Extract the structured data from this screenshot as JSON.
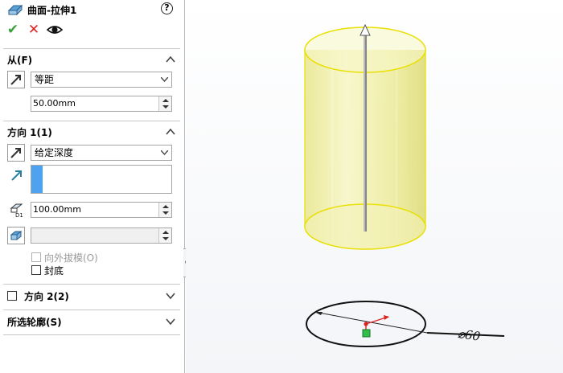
{
  "header": {
    "title": "曲面-拉伸1",
    "help": "?"
  },
  "actions": {
    "ok": "✔",
    "cancel": "✕"
  },
  "from": {
    "title": "从(F)",
    "type_value": "等距",
    "offset_value": "50.00mm"
  },
  "direction1": {
    "title": "方向 1(1)",
    "type_value": "给定深度",
    "depth_value": "100.00mm",
    "draft_value": "",
    "draft_outward_label": "向外拔模(O)",
    "cap_label": "封底"
  },
  "direction2": {
    "title": "方向 2(2)"
  },
  "contours": {
    "title": "所选轮廓(S)"
  },
  "viewport": {
    "dimension_label": "⌀60"
  },
  "colors": {
    "surface": "#f4f2a6",
    "edge": "#e8e000",
    "accent": "#4da3f0"
  }
}
